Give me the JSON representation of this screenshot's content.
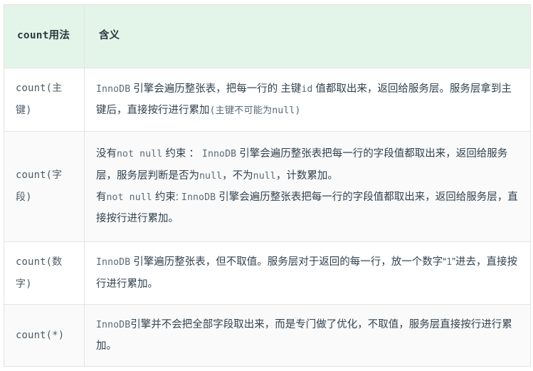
{
  "table": {
    "headers": {
      "usage": "count用法",
      "meaning": "含义"
    },
    "rows": [
      {
        "usage": "count(主键)",
        "meaning_parts": [
          {
            "type": "mono",
            "text": "InnoDB"
          },
          {
            "type": "cjk",
            "text": " 引擎会遍历整张表，把每一行的 "
          },
          {
            "type": "cjk",
            "text": "主键"
          },
          {
            "type": "mono",
            "text": "id"
          },
          {
            "type": "cjk",
            "text": " 值都取出来，返回给服务层。服务层拿到主键后，直接按行进行累加"
          },
          {
            "type": "mono",
            "text": "(主键不可能为null)"
          }
        ],
        "meaning_plain": "InnoDB 引擎会遍历整张表，把每一行的 主键id 值都取出来，返回给服务层。服务层拿到主键后，直接按行进行累加(主键不可能为null)",
        "zebra": false
      },
      {
        "usage": "count(字段)",
        "meaning_parts": [
          {
            "type": "cjk",
            "text": "没有"
          },
          {
            "type": "mono",
            "text": "not null"
          },
          {
            "type": "cjk",
            "text": " 约束 ： "
          },
          {
            "type": "mono",
            "text": "InnoDB"
          },
          {
            "type": "cjk",
            "text": " 引擎会遍历整张表把每一行的字段值都取出来，返回给服务层，服务层判断是否为"
          },
          {
            "type": "mono",
            "text": "null"
          },
          {
            "type": "cjk",
            "text": "，不为"
          },
          {
            "type": "mono",
            "text": "null"
          },
          {
            "type": "cjk",
            "text": "，计数累加。"
          },
          {
            "type": "break",
            "text": ""
          },
          {
            "type": "cjk",
            "text": "有"
          },
          {
            "type": "mono",
            "text": "not null"
          },
          {
            "type": "cjk",
            "text": " 约束: "
          },
          {
            "type": "mono",
            "text": "InnoDB"
          },
          {
            "type": "cjk",
            "text": " 引擎会遍历整张表把每一行的字段值都取出来，返回给服务层，直接按行进行累加。"
          }
        ],
        "meaning_plain": "没有not null 约束 ： InnoDB 引擎会遍历整张表把每一行的字段值都取出来，返回给服务层，服务层判断是否为null，不为null，计数累加。有not null 约束: InnoDB 引擎会遍历整张表把每一行的字段值都取出来，返回给服务层，直接按行进行累加。",
        "zebra": true
      },
      {
        "usage": "count(数字)",
        "meaning_parts": [
          {
            "type": "mono",
            "text": "InnoDB"
          },
          {
            "type": "cjk",
            "text": " 引擎遍历整张表，但不取值。服务层对于返回的每一行，放一个数字“"
          },
          {
            "type": "mono",
            "text": "1"
          },
          {
            "type": "cjk",
            "text": "”进去，直接按行进行累加。"
          }
        ],
        "meaning_plain": "InnoDB 引擎遍历整张表，但不取值。服务层对于返回的每一行，放一个数字“1”进去，直接按行进行累加。",
        "zebra": false
      },
      {
        "usage": "count(*)",
        "meaning_parts": [
          {
            "type": "mono",
            "text": "InnoDB"
          },
          {
            "type": "cjk",
            "text": "引擎并不会把全部字段取出来，而是专门做了优化，不取值，服务层直接按行进行累加。"
          }
        ],
        "meaning_plain": "InnoDB引擎并不会把全部字段取出来，而是专门做了优化，不取值，服务层直接按行进行累加。",
        "zebra": true
      }
    ]
  },
  "colors": {
    "header_background": "#e3f5e8",
    "header_text": "#2d3a41",
    "border": "#e3e3e3",
    "zebra_row_background": "#fafafa",
    "plain_row_background": "#ffffff",
    "body_text": "#31424f",
    "mono_text": "#5a6a77",
    "page_background": "#ffffff"
  }
}
